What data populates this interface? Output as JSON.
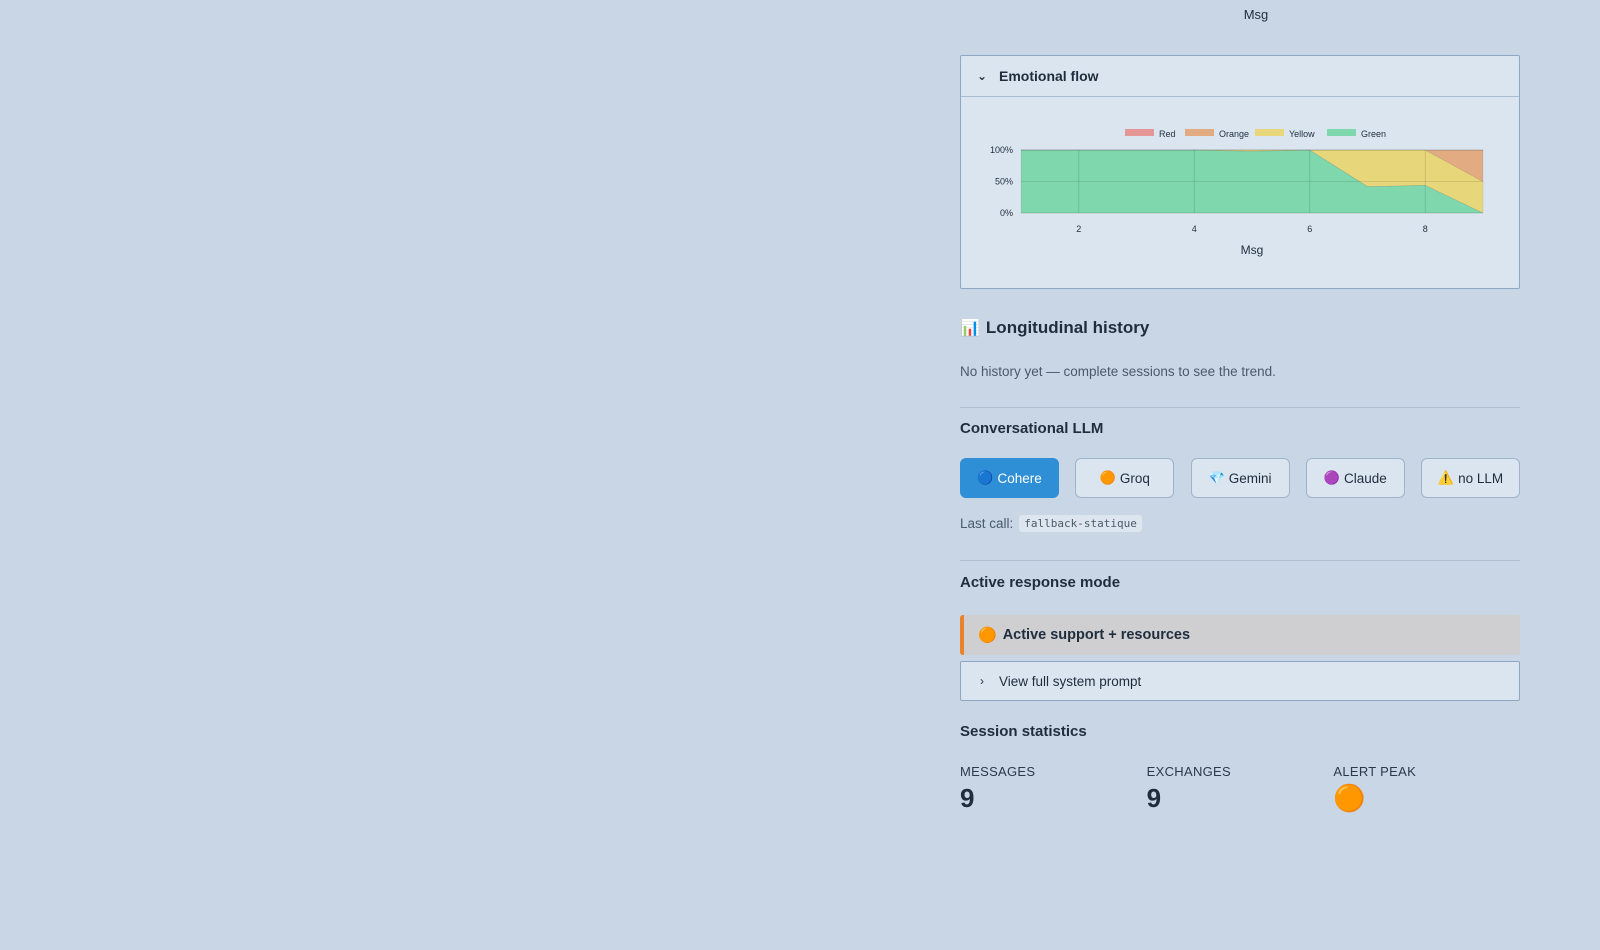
{
  "top_axis_label": "Msg",
  "emotional_flow": {
    "title": "Emotional flow",
    "chevron": "chevron-down-icon"
  },
  "chart_data": {
    "type": "area",
    "stacked": "percent",
    "x": [
      1,
      2,
      3,
      4,
      5,
      6,
      7,
      8,
      9
    ],
    "xticks": [
      2,
      4,
      6,
      8
    ],
    "xlabel": "Msg",
    "ylabel": "",
    "yticks": [
      "0%",
      "50%",
      "100%"
    ],
    "ylim": [
      0,
      100
    ],
    "legend_position": "top",
    "series": [
      {
        "name": "Green",
        "color": "#7fd8ad",
        "values": [
          100,
          100,
          100,
          100,
          98,
          100,
          42,
          44,
          0
        ]
      },
      {
        "name": "Yellow",
        "color": "#e8d67a",
        "values": [
          0,
          0,
          0,
          0,
          2,
          0,
          58,
          56,
          50
        ]
      },
      {
        "name": "Orange",
        "color": "#e3ab82",
        "values": [
          0,
          0,
          0,
          0,
          0,
          0,
          0,
          0,
          50
        ]
      },
      {
        "name": "Red",
        "color": "#e59797",
        "values": [
          0,
          0,
          0,
          0,
          0,
          0,
          0,
          0,
          0
        ]
      }
    ],
    "legend_order": [
      "Red",
      "Orange",
      "Yellow",
      "Green"
    ]
  },
  "history": {
    "icon": "bar-chart-icon",
    "icon_glyph": "📊",
    "title": "Longitudinal history",
    "empty_text": "No history yet — complete sessions to see the trend."
  },
  "llm": {
    "title": "Conversational LLM",
    "buttons": [
      {
        "emoji": "🔵",
        "label": "Cohere",
        "active": true
      },
      {
        "emoji": "🟠",
        "label": "Groq",
        "active": false
      },
      {
        "emoji": "💎",
        "label": "Gemini",
        "active": false
      },
      {
        "emoji": "🟣",
        "label": "Claude",
        "active": false
      },
      {
        "emoji": "⚠️",
        "label": "no LLM",
        "active": false
      }
    ],
    "last_call_label": "Last call:",
    "last_call_value": "fallback-statique"
  },
  "response_mode": {
    "title": "Active response mode",
    "emoji": "🟠",
    "value": "Active support + resources",
    "accent": "#e8822b",
    "prompt_toggle": "View full system prompt"
  },
  "stats": {
    "title": "Session statistics",
    "items": [
      {
        "label": "MESSAGES",
        "value": "9"
      },
      {
        "label": "EXCHANGES",
        "value": "9"
      },
      {
        "label": "ALERT PEAK",
        "value": "🟠"
      }
    ]
  }
}
